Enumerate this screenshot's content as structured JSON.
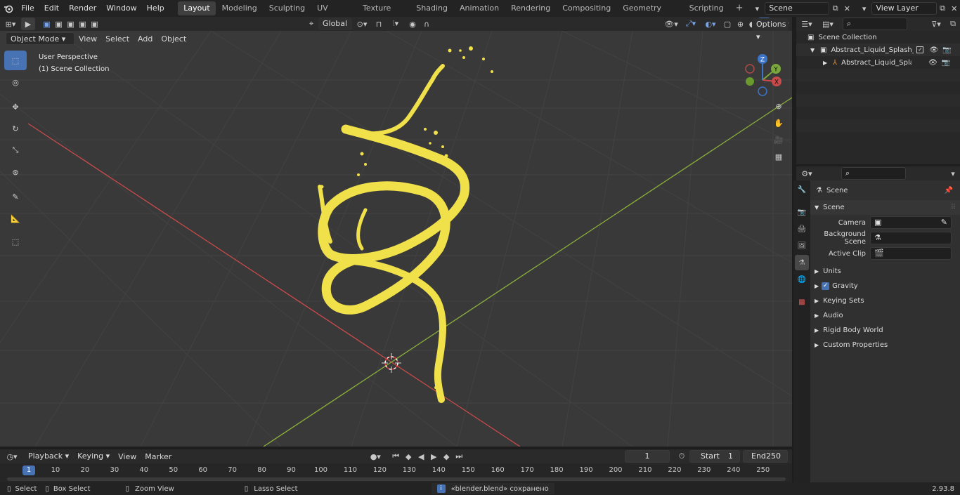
{
  "topbar": {
    "menus": [
      "File",
      "Edit",
      "Render",
      "Window",
      "Help"
    ],
    "workspaces": [
      "Layout",
      "Modeling",
      "Sculpting",
      "UV Editing",
      "Texture Paint",
      "Shading",
      "Animation",
      "Rendering",
      "Compositing",
      "Geometry Nodes",
      "Scripting"
    ],
    "active_workspace": "Layout",
    "add_tab": "+",
    "scene_name": "Scene",
    "view_layer": "View Layer"
  },
  "viewport_header": {
    "mode": "Object Mode",
    "menus": [
      "View",
      "Select",
      "Add",
      "Object"
    ],
    "transform_orientation": "Global",
    "options_label": "Options"
  },
  "viewport": {
    "perspective_label": "User Perspective",
    "collection_label": "(1) Scene Collection",
    "gizmo": {
      "z": "Z",
      "y": "Y",
      "x": "X"
    }
  },
  "outliner": {
    "root": "Scene Collection",
    "items": [
      {
        "label": "Abstract_Liquid_Splash_Orang",
        "level": 1
      },
      {
        "label": "Abstract_Liquid_Splash_(",
        "level": 2
      }
    ]
  },
  "properties": {
    "context": "Scene",
    "panel": "Scene",
    "fields": [
      {
        "label": "Camera"
      },
      {
        "label": "Background Scene"
      },
      {
        "label": "Active Clip"
      }
    ],
    "subpanels": [
      {
        "label": "Units",
        "checkbox": false
      },
      {
        "label": "Gravity",
        "checkbox": true
      },
      {
        "label": "Keying Sets",
        "checkbox": false
      },
      {
        "label": "Audio",
        "checkbox": false
      },
      {
        "label": "Rigid Body World",
        "checkbox": false
      },
      {
        "label": "Custom Properties",
        "checkbox": false
      }
    ]
  },
  "timeline": {
    "menus": [
      "Playback",
      "Keying",
      "View",
      "Marker"
    ],
    "current_frame": "1",
    "start_label": "Start",
    "start_value": "1",
    "end_label": "End",
    "end_value": "250",
    "ticks": [
      "1",
      "10",
      "20",
      "30",
      "40",
      "50",
      "60",
      "70",
      "80",
      "90",
      "100",
      "110",
      "120",
      "130",
      "140",
      "150",
      "160",
      "170",
      "180",
      "190",
      "200",
      "210",
      "220",
      "230",
      "240",
      "250"
    ]
  },
  "statusbar": {
    "select": "Select",
    "box_select": "Box Select",
    "zoom_view": "Zoom View",
    "lasso_select": "Lasso Select",
    "message": "«blender.blend» сохранено",
    "version": "2.93.8"
  },
  "colors": {
    "accent": "#4772b3",
    "splash": "#f0e04a",
    "x_axis": "#c94a4a",
    "y_axis": "#8bb03a"
  }
}
